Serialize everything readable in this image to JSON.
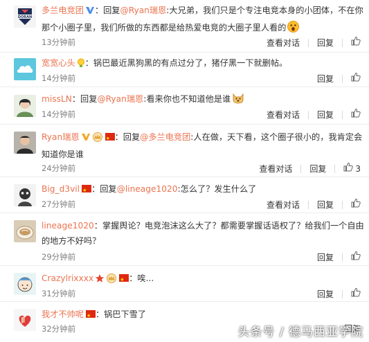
{
  "colors": {
    "accent": "#eb7350",
    "muted": "#808080",
    "divider": "#ececec"
  },
  "comments": [
    {
      "user": "多兰电竞团",
      "badges": [
        "verified-v-icon"
      ],
      "reply_prefix": "：回复",
      "mention": "@Ryan瑞恩",
      "text_line1": ":大兄弟，我们只是个专注电竞本身的小团体，不在你",
      "text_line2": "那个小圈子里，我们所做的东西都是给热爱电竞的大圈子里人看的",
      "emoji": "surprised-emoji-icon",
      "time": "13分钟前",
      "actions": [
        "查看对话",
        "回复"
      ]
    },
    {
      "user": "宽宽心头",
      "badges": [
        "bulb-icon"
      ],
      "text_line1": "：锅巴最近黑狗黑的有点过分了，猪仔黑一下就删帖。",
      "time": "14分钟前",
      "actions": [
        "回复"
      ]
    },
    {
      "user": "missLN",
      "reply_prefix": "：回复",
      "mention": "@Ryan瑞恩",
      "text_line1": ":看来你也不知道他是谁",
      "emoji": "doge-emoji-icon",
      "time": "14分钟前",
      "actions": [
        "查看对话",
        "回复"
      ]
    },
    {
      "user": "Ryan瑞恩",
      "badges": [
        "verified-v-icon",
        "crown-icon",
        "china-flag-icon"
      ],
      "reply_prefix": "：回复",
      "mention": "@多兰电竞团",
      "text_line1": ":人在做，天下看，这个圈子很小的，我肯定会",
      "text_line2": "知道你是谁",
      "time": "24分钟前",
      "actions": [
        "查看对话",
        "回复"
      ],
      "likes": "3"
    },
    {
      "user": "Big_d3vil",
      "badges": [
        "china-flag-icon"
      ],
      "reply_prefix": "：回复",
      "mention": "@lineage1020",
      "text_line1": ":怎么了？发生什么了",
      "time": "27分钟前",
      "actions": [
        "查看对话",
        "回复"
      ]
    },
    {
      "user": "lineage1020",
      "text_line1": "：掌握舆论？电竞泡沫这么大了？都需要掌握话语权了？给我们一个自由",
      "text_line2": "的地方不好吗？",
      "time": "29分钟前",
      "actions": [
        "回复"
      ]
    },
    {
      "user": "Crazylrixxxx",
      "badges": [
        "star-icon",
        "crown-icon",
        "china-flag-icon"
      ],
      "text_line1": "：唉...",
      "time": "31分钟前",
      "actions": [
        "回复"
      ]
    },
    {
      "user": "我才不帅呢",
      "badges": [
        "china-flag-icon"
      ],
      "text_line1": "：锅巴下雪了",
      "time": "32分钟前",
      "actions": [
        "回复"
      ]
    }
  ],
  "watermark": "头条号 / 德马西亚学院"
}
